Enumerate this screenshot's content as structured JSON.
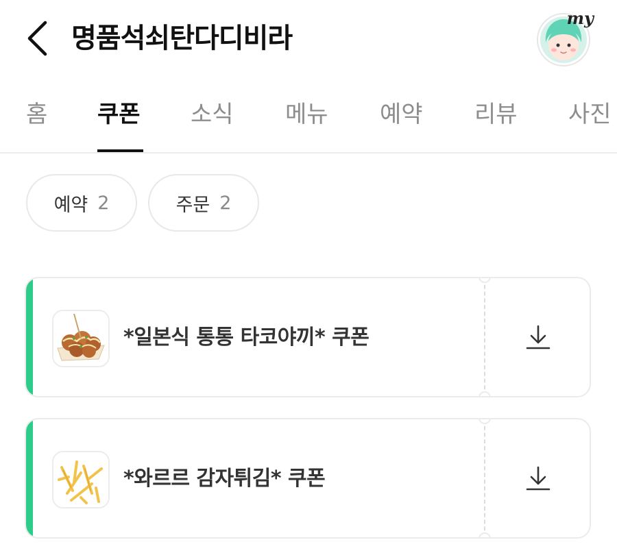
{
  "header": {
    "title": "명품석쇠탄다디비라",
    "back_icon": "chevron-left-icon",
    "profile_badge": "my"
  },
  "tabs": [
    {
      "label": "홈",
      "active": false
    },
    {
      "label": "쿠폰",
      "active": true
    },
    {
      "label": "소식",
      "active": false
    },
    {
      "label": "메뉴",
      "active": false
    },
    {
      "label": "예약",
      "active": false
    },
    {
      "label": "리뷰",
      "active": false
    },
    {
      "label": "사진",
      "active": false
    }
  ],
  "filters": [
    {
      "label": "예약",
      "count": "2"
    },
    {
      "label": "주문",
      "count": "2"
    }
  ],
  "coupons": [
    {
      "name": "*일본식 통통 타코야끼* 쿠폰",
      "image": "takoyaki-image",
      "action_icon": "download-icon"
    },
    {
      "name": "*와르르 감자튀김* 쿠폰",
      "image": "french-fries-image",
      "action_icon": "download-icon"
    }
  ],
  "colors": {
    "accent": "#2ecc8a",
    "active_tab": "#111111",
    "inactive_tab": "#8d8d8d"
  }
}
